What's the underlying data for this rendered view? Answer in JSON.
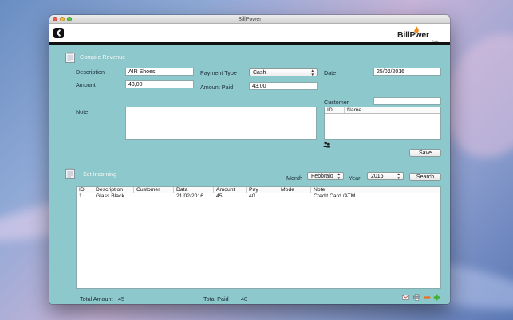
{
  "window": {
    "title": "BillPower"
  },
  "logo": {
    "text_bill": "Bill",
    "text_power": "Pwer",
    "sub": "Trade"
  },
  "compile": {
    "title": "Compile Revenue",
    "description_label": "Description",
    "description_value": "AIR Shoes",
    "payment_type_label": "Payment Type",
    "payment_type_value": "Cash",
    "date_label": "Date",
    "date_value": "25/02/2016",
    "amount_label": "Amount",
    "amount_value": "43,00",
    "amount_paid_label": "Amount Paid",
    "amount_paid_value": "43,00",
    "customer_label": "Customer",
    "customer_value": "",
    "note_label": "Note",
    "customer_table": {
      "col_id": "ID",
      "col_name": "Name"
    },
    "save_label": "Save"
  },
  "incoming": {
    "title": "Set Incoming",
    "month_label": "Month",
    "month_value": "Febbraio",
    "year_label": "Year",
    "year_value": "2016",
    "search_label": "Search",
    "columns": [
      "ID",
      "Description",
      "Customer",
      "Data",
      "Amount",
      "Pay",
      "Mode",
      "Note"
    ],
    "rows": [
      [
        "1",
        "Glass Black",
        "",
        "21/02/2016",
        "45",
        "40",
        "",
        "Credit Card /ATM"
      ]
    ]
  },
  "footer": {
    "total_amount_label": "Total Amount",
    "total_amount_value": "45",
    "total_paid_label": "Total Paid",
    "total_paid_value": "40"
  },
  "toolbar_icons": [
    "mail-icon",
    "print-icon",
    "remove-icon",
    "add-icon"
  ],
  "colors": {
    "window_bg": "#8dc9cc",
    "accent_flame": "#f08a1c",
    "add_green": "#3fae2a",
    "remove_orange": "#e8711f"
  }
}
